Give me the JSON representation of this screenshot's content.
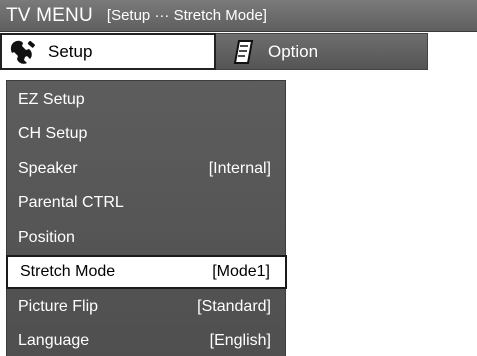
{
  "title_bar": {
    "title": "TV MENU",
    "breadcrumb": "[Setup ··· Stretch Mode]"
  },
  "tabs": [
    {
      "label": "Setup",
      "icon": "wrench-icon",
      "active": true
    },
    {
      "label": "Option",
      "icon": "notepad-icon",
      "active": false
    }
  ],
  "menu": {
    "items": [
      {
        "label": "EZ Setup",
        "value": ""
      },
      {
        "label": "CH Setup",
        "value": ""
      },
      {
        "label": "Speaker",
        "value": "[Internal]"
      },
      {
        "label": "Parental CTRL",
        "value": ""
      },
      {
        "label": "Position",
        "value": ""
      },
      {
        "label": "Stretch Mode",
        "value": "[Mode1]",
        "selected": true
      },
      {
        "label": "Picture Flip",
        "value": "[Standard]"
      },
      {
        "label": "Language",
        "value": "[English]"
      }
    ]
  },
  "colors": {
    "bar_gray": "#666666",
    "panel_gray": "#555555",
    "highlight": "#ffffff",
    "text_light": "#ffffff",
    "text_dark": "#000000"
  }
}
